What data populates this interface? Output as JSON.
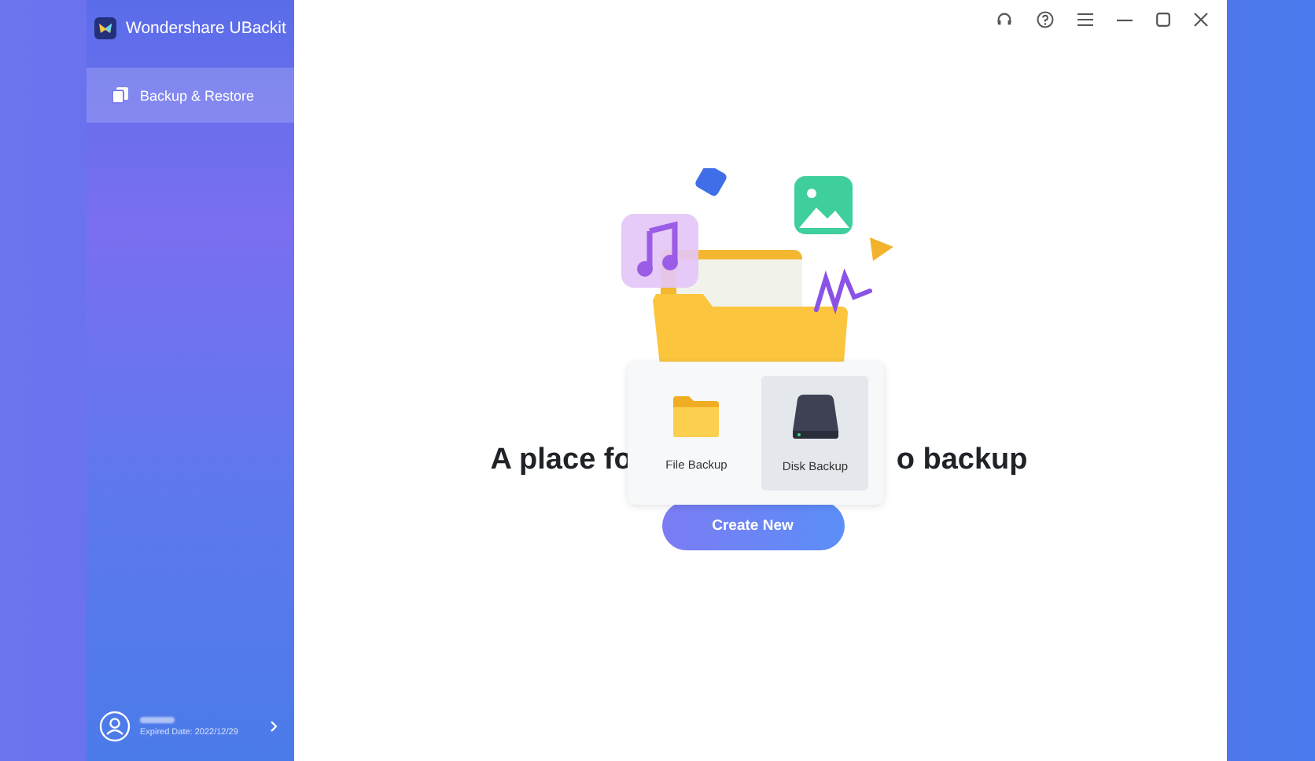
{
  "window": {
    "title": "Wondershare UBackit"
  },
  "sidebar": {
    "items": [
      {
        "label": "Backup & Restore",
        "selected": true
      }
    ],
    "account": {
      "expiry": "Expired Date: 2022/12/29"
    }
  },
  "main": {
    "heading_parts": [
      "A place fo",
      "o backup"
    ],
    "button": "Create New"
  },
  "popup": {
    "items": [
      {
        "kind": "file",
        "label": "File Backup",
        "selected": false
      },
      {
        "kind": "disk",
        "label": "Disk Backup",
        "selected": true
      }
    ]
  }
}
